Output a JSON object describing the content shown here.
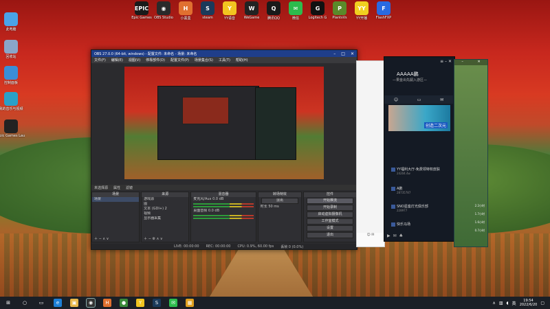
{
  "desktop": {
    "left_icons": [
      {
        "label": "此电脑",
        "icon": "computer-icon",
        "color": "#4aa3e8"
      },
      {
        "label": "回收站",
        "icon": "recycle-bin-icon",
        "color": "#8aa6c8"
      },
      {
        "label": "控制面板",
        "icon": "control-panel-icon",
        "color": "#3b8ed8"
      },
      {
        "label": "我的音乐与视频",
        "icon": "music-icon",
        "color": "#2aa0c8"
      },
      {
        "label": "Epic Games Launcher",
        "icon": "epic-icon",
        "color": "#222222"
      }
    ],
    "top_icons": [
      {
        "label": "Epic Games",
        "icon": "epic-icon",
        "color": "#1a1a1a",
        "glyph": "EPIC"
      },
      {
        "label": "OBS Studio",
        "icon": "obs-icon",
        "color": "#2a2a2a",
        "glyph": "◉"
      },
      {
        "label": "小黑盒",
        "icon": "heybox-icon",
        "color": "#e07030",
        "glyph": "H"
      },
      {
        "label": "steam",
        "icon": "steam-icon",
        "color": "#1b3a5a",
        "glyph": "S"
      },
      {
        "label": "YY语音",
        "icon": "yy-icon",
        "color": "#f2c520",
        "glyph": "Y"
      },
      {
        "label": "WeGame",
        "icon": "wegame-icon",
        "color": "#222222",
        "glyph": "W"
      },
      {
        "label": "腾讯QQ",
        "icon": "qq-icon",
        "color": "#1a1a1a",
        "glyph": "Q"
      },
      {
        "label": "微信",
        "icon": "wechat-icon",
        "color": "#2dbb4d",
        "glyph": "✉"
      },
      {
        "label": "Logitech G",
        "icon": "logitech-icon",
        "color": "#111111",
        "glyph": "G"
      },
      {
        "label": "PlantsVs",
        "icon": "plants-icon",
        "color": "#5a8a2a",
        "glyph": "P"
      },
      {
        "label": "YY开播",
        "icon": "yy-live-icon",
        "color": "#f0d020",
        "glyph": "YY"
      },
      {
        "label": "FlashFXP",
        "icon": "flash-icon",
        "color": "#2a6ae0",
        "glyph": "F"
      }
    ]
  },
  "obs": {
    "title": "OBS 27.0.0 (64-bit, windows) - 配置文件: 未命名 - 场景: 未命名",
    "menu": [
      "文件(F)",
      "编辑(E)",
      "视图(V)",
      "停靠部件(D)",
      "配置文件(P)",
      "场景集合(S)",
      "工具(T)",
      "帮助(H)"
    ],
    "source_bar": [
      "未选择源",
      "属性",
      "滤镜"
    ],
    "docks": {
      "scenes": {
        "header": "场景",
        "items": [
          "场景"
        ]
      },
      "sources": {
        "header": "来源",
        "items": [
          "游戏源",
          "图",
          "文本 (GDI+) 2",
          "视频",
          "显示器采集"
        ]
      },
      "mixer": {
        "header": "混音器",
        "tracks": [
          {
            "name": "麦克风/Aux",
            "level": "0.0 dB"
          },
          {
            "name": "桌面音频",
            "level": "0.0 dB"
          }
        ]
      },
      "transitions": {
        "header": "转场特效",
        "type": "淡出",
        "duration_label": "时长",
        "duration": "50 ms"
      },
      "controls": {
        "header": "控件",
        "buttons": [
          "开始推流",
          "开始录制",
          "启动虚拟摄像机",
          "工作室模式",
          "设置",
          "退出"
        ]
      }
    },
    "status": {
      "live": "LIVE: 00:00:00",
      "rec": "REC: 00:00:00",
      "cpu": "CPU: 0.9%, 60.00 fps",
      "drop": "丢帧 0 (0.0%)"
    }
  },
  "side_app": {
    "name": "AAAAA鹏",
    "subtitle": "—果金出先嗣入游区—",
    "banner_text": "创造二次元",
    "items": [
      {
        "title": "YY福利大厅-免费领特权皮肤",
        "sub": "24204.4w"
      },
      {
        "title": "A鹏",
        "sub": "28735787"
      },
      {
        "title": "SNO星座灯光俱乐部",
        "sub": "228977"
      },
      {
        "title": "快乐马场",
        "sub": ""
      }
    ]
  },
  "green_panel": {
    "numbers": [
      "2.2小时",
      "1.7小时",
      "1.6小时",
      "0.7小时"
    ]
  },
  "taskbar": {
    "apps": [
      {
        "icon": "windows-start-icon",
        "color": "#1b1f26",
        "glyph": "⊞"
      },
      {
        "icon": "search-icon",
        "color": "#1b1f26",
        "glyph": "○"
      },
      {
        "icon": "task-view-icon",
        "color": "#1b1f26",
        "glyph": "▭"
      },
      {
        "icon": "edge-icon",
        "color": "#1e7fd6",
        "glyph": "e"
      },
      {
        "icon": "file-explorer-icon",
        "color": "#e8b84a",
        "glyph": "▣"
      },
      {
        "icon": "obs-taskbar-icon",
        "color": "#333333",
        "glyph": "◉"
      },
      {
        "icon": "heybox-taskbar-icon",
        "color": "#e07030",
        "glyph": "H"
      },
      {
        "icon": "chrome-icon",
        "color": "#3a8a3a",
        "glyph": "●"
      },
      {
        "icon": "yy-taskbar-icon",
        "color": "#f2c520",
        "glyph": "Y"
      },
      {
        "icon": "steam-taskbar-icon",
        "color": "#1b3a5a",
        "glyph": "S"
      },
      {
        "icon": "wechat-taskbar-icon",
        "color": "#2dbb4d",
        "glyph": "✉"
      },
      {
        "icon": "store-icon",
        "color": "#e0a020",
        "glyph": "▦"
      }
    ],
    "time": "19:54",
    "date": "2022/6/20",
    "tray_lang": "英"
  }
}
